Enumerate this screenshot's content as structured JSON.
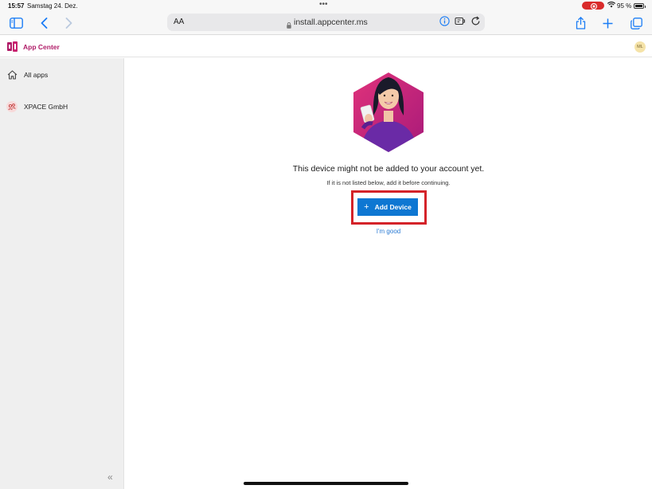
{
  "status_bar": {
    "time": "15:57",
    "date": "Samstag 24. Dez.",
    "dots": "•••",
    "battery_percent": "95 %"
  },
  "browser": {
    "text_size_label": "AA",
    "url": "install.appcenter.ms",
    "accent_color": "#1a7cf5"
  },
  "app": {
    "brand": "App Center",
    "brand_color": "#b01c68",
    "avatar_initials": "ML"
  },
  "sidebar": {
    "items": [
      {
        "label": "All apps",
        "icon": "home-icon"
      },
      {
        "label": "XPACE GmbH",
        "icon": "organization-icon"
      }
    ],
    "collapse_label": "«"
  },
  "main": {
    "message": "This device might not be added to your account yet.",
    "sub_message": "If it is not listed below, add it before continuing.",
    "add_device_label": "Add Device",
    "add_device_icon": "plus-icon",
    "dismiss_label": "I'm good",
    "button_color": "#0e77d2",
    "highlight_color": "#d42329"
  }
}
